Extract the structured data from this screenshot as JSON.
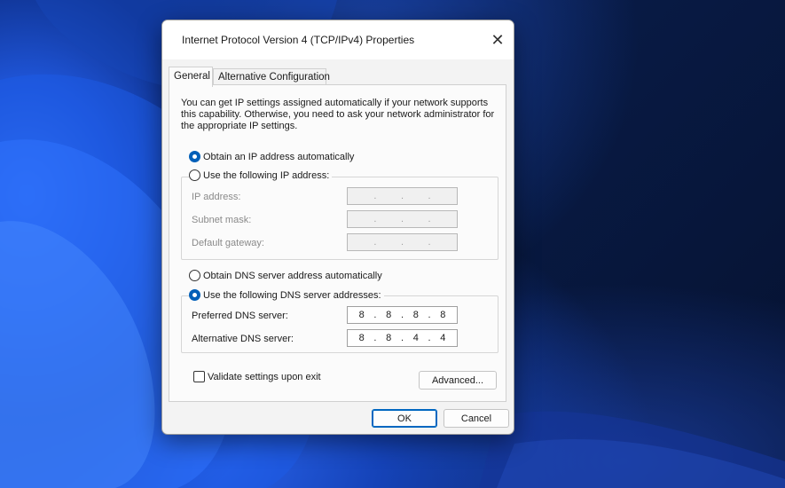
{
  "dialog": {
    "title": "Internet Protocol Version 4 (TCP/IPv4) Properties",
    "close_icon": "close-icon"
  },
  "tabs": [
    {
      "label": "General",
      "active": true
    },
    {
      "label": "Alternative Configuration",
      "active": false
    }
  ],
  "general": {
    "intro": "You can get IP settings assigned automatically if your network supports this capability. Otherwise, you need to ask your network administrator for the appropriate IP settings.",
    "ip_auto_label": "Obtain an IP address automatically",
    "ip_manual_label": "Use the following IP address:",
    "ip_mode": "automatic",
    "ip_fields": [
      {
        "label": "IP address:",
        "octets": [
          "",
          "",
          "",
          ""
        ]
      },
      {
        "label": "Subnet mask:",
        "octets": [
          "",
          "",
          "",
          ""
        ]
      },
      {
        "label": "Default gateway:",
        "octets": [
          "",
          "",
          "",
          ""
        ]
      }
    ],
    "ip_separator": ".",
    "dns_auto_label": "Obtain DNS server address automatically",
    "dns_manual_label": "Use the following DNS server addresses:",
    "dns_mode": "manual",
    "dns_fields": [
      {
        "label": "Preferred DNS server:",
        "octets": [
          "8",
          "8",
          "8",
          "8"
        ]
      },
      {
        "label": "Alternative DNS server:",
        "octets": [
          "8",
          "8",
          "4",
          "4"
        ]
      }
    ],
    "validate_label": "Validate settings upon exit",
    "validate_checked": false,
    "advanced_label": "Advanced..."
  },
  "footer": {
    "ok_label": "OK",
    "cancel_label": "Cancel"
  },
  "colors": {
    "accent": "#005fb8",
    "dialog_bg": "#f3f3f3"
  }
}
